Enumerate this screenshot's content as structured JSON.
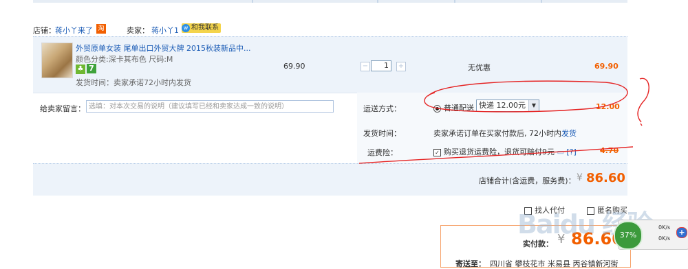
{
  "shop": {
    "shop_label": "店铺：",
    "shop_name": "蒋小丫来了",
    "shop_badge": "淘",
    "seller_label": "卖家：",
    "seller_name": "蒋小丫1",
    "contact_label": "和我联系"
  },
  "item": {
    "title": "外贸原单女装 尾单出口外贸大牌 2015秋装新品中...",
    "attrs": "颜色分类:深卡其布色  尺码:M",
    "badge_icon": "leaf-icon",
    "badge_seven": "7",
    "ship_time": "发货时间：卖家承诺72小时内发货",
    "unit_price": "69.90",
    "qty_minus": "−",
    "quantity": "1",
    "qty_plus": "+",
    "discount": "无优惠",
    "subtotal": "69.90"
  },
  "message": {
    "label": "给卖家留言：",
    "placeholder": "选填：对本次交易的说明（建议填写已经和卖家达成一致的说明）"
  },
  "shipping": {
    "method_label": "运送方式：",
    "option_label": "普通配送",
    "selected_option": "快递 12.00元",
    "fee": "12.00",
    "time_label": "发货时间：",
    "time_text_1": "卖家承诺订单在买家付款后, 72小时内",
    "time_text_link": "发货",
    "insurance_label": "运费险：",
    "insurance_text": "购买退货运费险，退货可赔付9元",
    "insurance_help": "[?]",
    "insurance_fee": "4.70"
  },
  "total": {
    "label": "店铺合计(含运费，服务费)：",
    "currency": "¥",
    "amount": "86.60"
  },
  "options": {
    "proxy_pay": "找人代付",
    "anonymous": "匿名购买"
  },
  "pay": {
    "label": "实付款：",
    "currency": "¥",
    "amount": "86.60",
    "ship_to_label": "寄送至：",
    "ship_to_addr": "四川省 攀枝花市 米易县 丙谷镇新河街"
  },
  "overlay": {
    "watermark": "Baidu 经验",
    "percent": "37%",
    "up_speed": "0K/s",
    "down_speed": "0K/s",
    "plus": "+"
  }
}
